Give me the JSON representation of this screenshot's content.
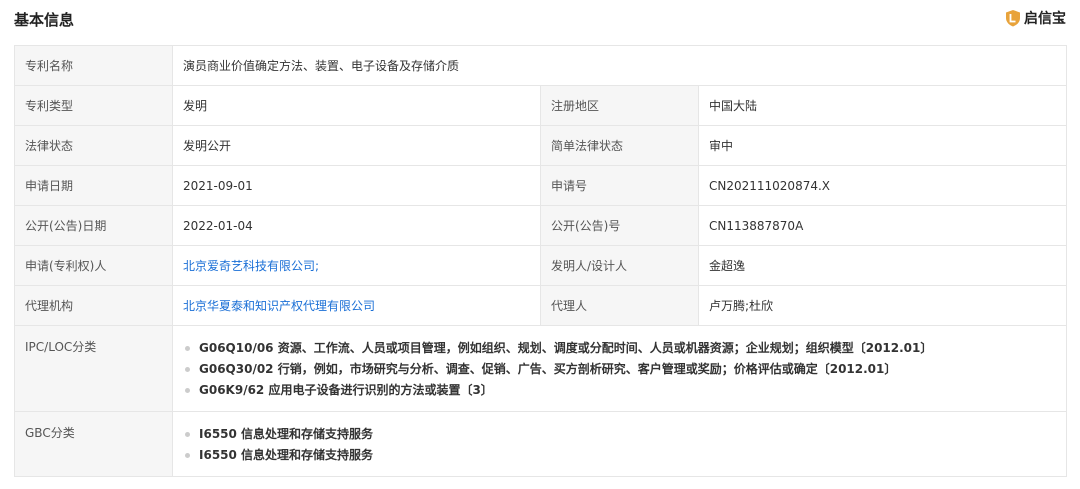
{
  "header": {
    "title": "基本信息",
    "brand": "启信宝",
    "brand_color": "#e8a33b"
  },
  "rows": {
    "patent_name": {
      "label": "专利名称",
      "value": "演员商业价值确定方法、装置、电子设备及存储介质"
    },
    "patent_type": {
      "label": "专利类型",
      "value": "发明",
      "label2": "注册地区",
      "value2": "中国大陆"
    },
    "legal_status": {
      "label": "法律状态",
      "value": "发明公开",
      "label2": "简单法律状态",
      "value2": "审中"
    },
    "apply_date": {
      "label": "申请日期",
      "value": "2021-09-01",
      "label2": "申请号",
      "value2": "CN202111020874.X"
    },
    "publish_date": {
      "label": "公开(公告)日期",
      "value": "2022-01-04",
      "label2": "公开(公告)号",
      "value2": "CN113887870A"
    },
    "applicant": {
      "label": "申请(专利权)人",
      "value": "北京爱奇艺科技有限公司;",
      "label2": "发明人/设计人",
      "value2": "金超逸"
    },
    "agency": {
      "label": "代理机构",
      "value": "北京华夏泰和知识产权代理有限公司",
      "label2": "代理人",
      "value2": "卢万腾;杜欣"
    },
    "ipc": {
      "label": "IPC/LOC分类",
      "items": [
        "G06Q10/06  资源、工作流、人员或项目管理，例如组织、规划、调度或分配时间、人员或机器资源；企业规划；组织模型〔2012.01〕",
        "G06Q30/02  行销，例如，市场研究与分析、调查、促销、广告、买方剖析研究、客户管理或奖励；价格评估或确定〔2012.01〕",
        "G06K9/62  应用电子设备进行识别的方法或装置〔3〕"
      ]
    },
    "gbc": {
      "label": "GBC分类",
      "items": [
        "I6550  信息处理和存储支持服务",
        "I6550  信息处理和存储支持服务"
      ]
    }
  }
}
